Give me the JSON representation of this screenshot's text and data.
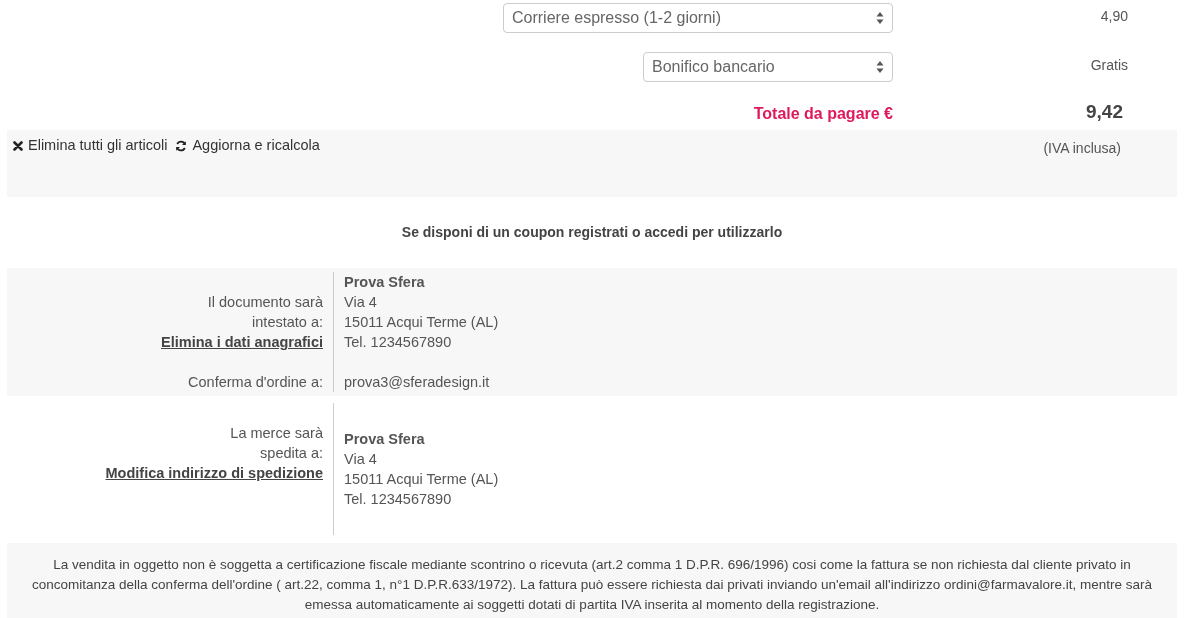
{
  "options": [
    {
      "kind": "shipping",
      "value": "Corriere espresso (1-2 giorni)",
      "price": "4,90"
    },
    {
      "kind": "payment",
      "value": "Bonifico bancario",
      "price": "Gratis"
    }
  ],
  "total": {
    "label": "Totale da pagare €",
    "amount": "9,42",
    "note": "(IVA inclusa)"
  },
  "actions": [
    {
      "kind": "delete",
      "label": "Elimina tutti gli articoli"
    },
    {
      "kind": "refresh",
      "label": "Aggiorna e ricalcola"
    }
  ],
  "coupon_notice": "Se disponi di un coupon registrati o accedi per utilizzarlo",
  "billing": {
    "label_lines": [
      "Il documento sarà",
      "intestato a:"
    ],
    "link": "Elimina i dati anagrafici",
    "name": "Prova Sfera",
    "lines": [
      "Via 4",
      "15011 Acqui Terme (AL)",
      "Tel. 1234567890"
    ],
    "confirm_label": "Conferma d'ordine a:",
    "confirm_email": "prova3@sferadesign.it"
  },
  "shipping_address": {
    "label_lines": [
      "La merce sarà",
      "spedita a:"
    ],
    "link": "Modifica indirizzo di spedizione",
    "name": "Prova Sfera",
    "lines": [
      "Via 4",
      "15011 Acqui Terme (AL)",
      "Tel. 1234567890"
    ]
  },
  "disclaimer": "La vendita in oggetto non è soggetta a certificazione fiscale mediante scontrino o ricevuta (art.2 comma 1 D.P.R. 696/1996) cosi come la fattura se non richiesta dal cliente privato in concomitanza della conferma dell'ordine ( art.22, comma 1, n°1 D.P.R.633/1972). La fattura può essere richiesta dai privati inviando un'email all'indirizzo ordini@farmavalore.it, mentre sarà emessa automaticamente ai soggetti dotati di partita IVA inserita al momento della registrazione."
}
